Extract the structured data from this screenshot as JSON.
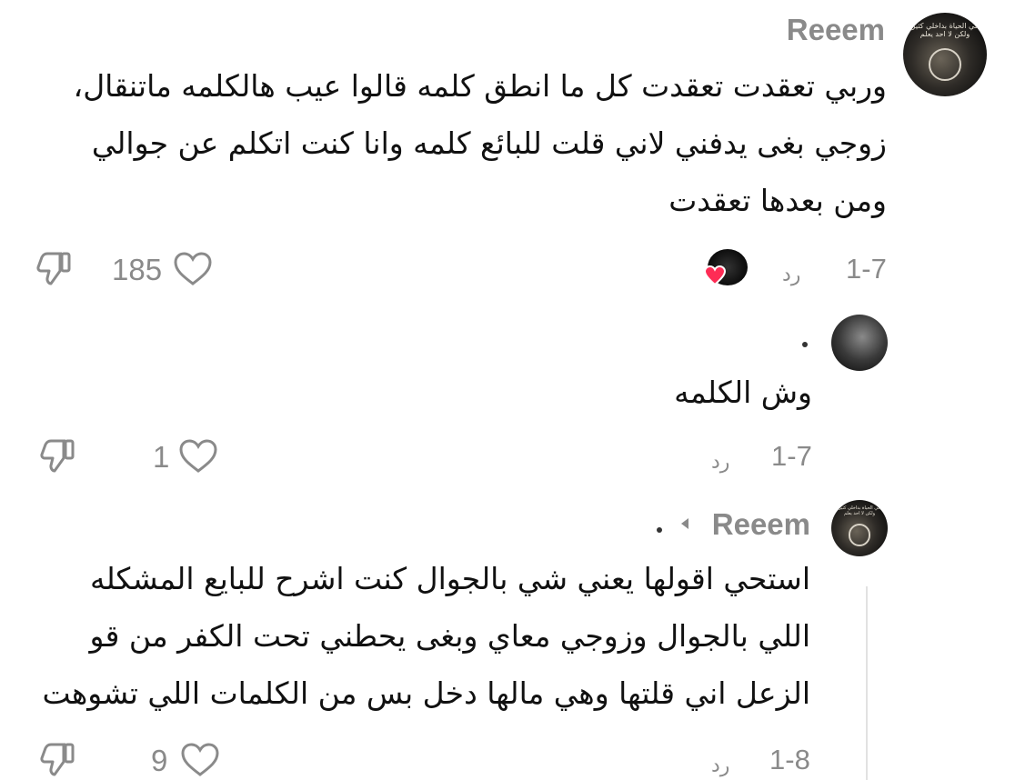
{
  "comments": [
    {
      "username": "Reeem",
      "lines": [
        "وربي تعقدت تعقدت كل ما انطق كلمه قالوا عيب هالكلمه ماتنقال،",
        "زوجي بغى يدفني لاني قلت للبائع كلمه وانا كنت اتكلم عن جوالي",
        "ومن بعدها تعقدت"
      ],
      "date": "1-7",
      "reply_label": "رد",
      "likes": "185",
      "avatar_text": "في الحياة بداخلي كثير ولكن لا احد يعلم"
    },
    {
      "username": ".",
      "lines": [
        "وش الكلمه"
      ],
      "date": "1-7",
      "reply_label": "رد",
      "likes": "1"
    },
    {
      "username": "Reeem",
      "reply_to": ".",
      "lines": [
        "استحي اقولها يعني شي بالجوال كنت اشرح للبايع المشكله",
        "اللي بالجوال وزوجي معاي وبغى يحطني تحت الكفر من قو",
        "الزعل اني قلتها وهي مالها دخل بس من الكلمات اللي تشوهت"
      ],
      "date": "1-8",
      "reply_label": "رد",
      "likes": "9",
      "avatar_text": "في الحياة بداخلي كثير ولكن لا احد يعلم"
    }
  ],
  "colors": {
    "muted": "#8a8a8a",
    "text": "#111111",
    "heart_red": "#fe2c55"
  }
}
